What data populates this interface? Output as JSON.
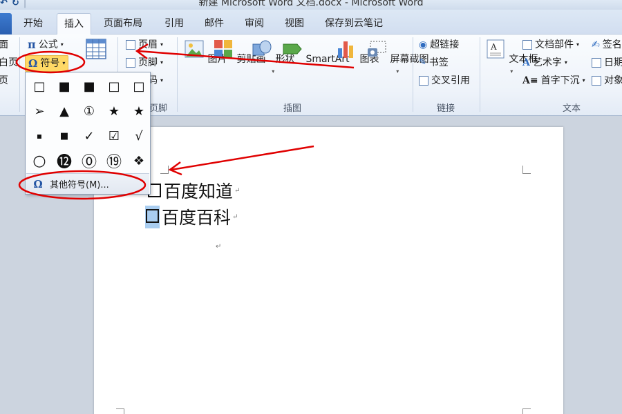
{
  "window": {
    "title": "新建 Microsoft Word 文档.docx - Microsoft Word",
    "qat": [
      "↶",
      "↻"
    ]
  },
  "tabs": [
    "开始",
    "插入",
    "页面布局",
    "引用",
    "邮件",
    "审阅",
    "视图",
    "保存到云笔记"
  ],
  "active_tab": "插入",
  "ribbon": {
    "left_partial": [
      "面",
      "白页",
      "页"
    ],
    "symbols_group": {
      "formula_label": "公式",
      "symbol_label": "符号",
      "formula_icon": "pi-icon",
      "symbol_icon": "omega-icon"
    },
    "table_partial_label": "表格",
    "header_footer_group": {
      "items": [
        "页眉",
        "页脚",
        "页码"
      ],
      "label": "页脚"
    },
    "illustrations_group": {
      "buttons": [
        "图片",
        "剪贴画",
        "形状",
        "SmartArt",
        "图表",
        "屏幕截图"
      ],
      "label": "插图"
    },
    "links_group": {
      "items": [
        "超链接",
        "书签",
        "交叉引用"
      ],
      "label": "链接"
    },
    "text_group": {
      "textbox_label": "文本框",
      "items_col1": [
        "文档部件",
        "艺术字",
        "首字下沉"
      ],
      "items_col2": [
        "签名",
        "日期",
        "对象"
      ],
      "label": "文本"
    }
  },
  "symbol_dropdown": {
    "symbols": [
      "□",
      "■",
      "■",
      "□",
      "□",
      "➢",
      "▲",
      "①",
      "★",
      "★",
      "▪",
      "■",
      "✓",
      "☑",
      "√",
      "○",
      "⓬",
      "⓪",
      "⑲",
      "❖"
    ],
    "more_label": "其他符号(M)..."
  },
  "document": {
    "lines": [
      "百度知道",
      "百度百科"
    ],
    "paragraph_mark": "↵"
  },
  "colors": {
    "annotation_red": "#e00000",
    "highlight": "#ffd966",
    "selection": "#a9cdf0"
  }
}
